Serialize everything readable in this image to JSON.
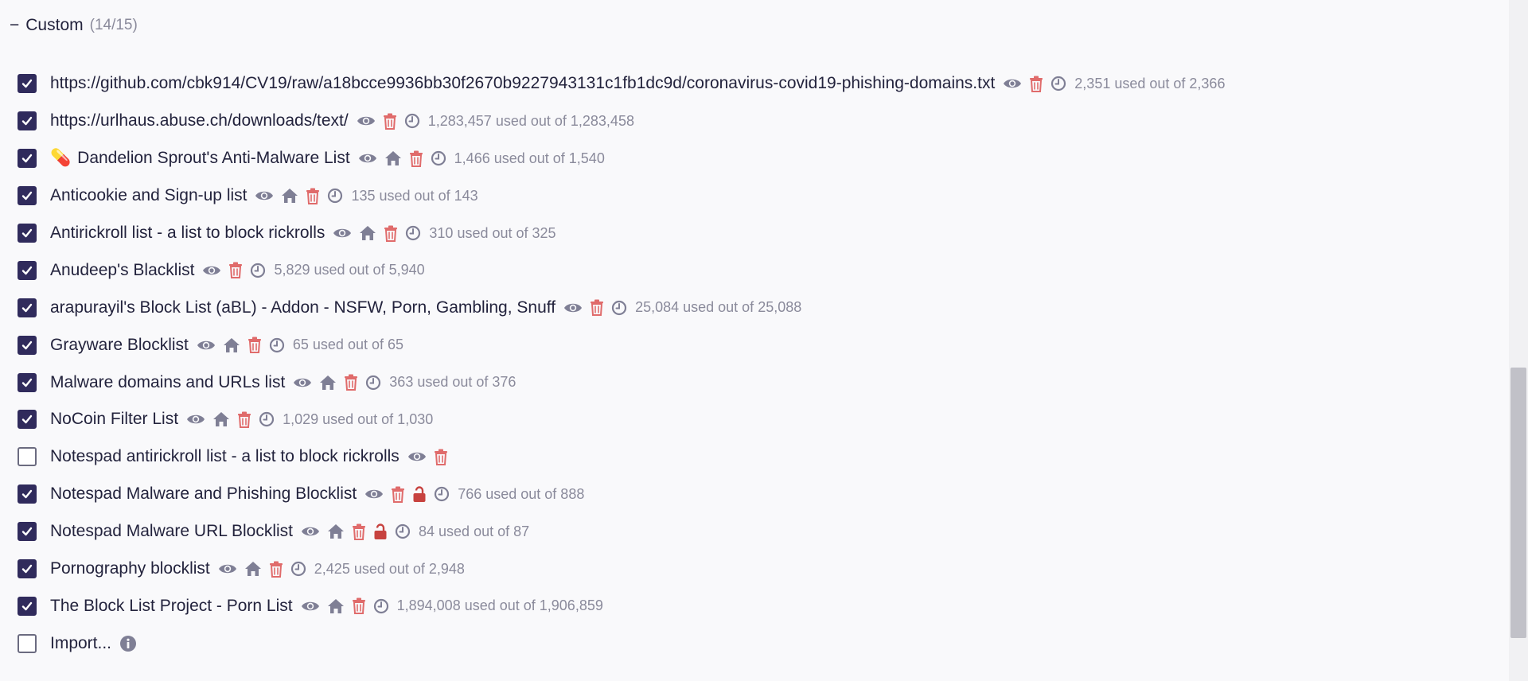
{
  "section": {
    "toggle": "−",
    "title": "Custom",
    "count": "(14/15)"
  },
  "colors": {
    "checkbox": "#302b5c",
    "view_icon": "#7f7f95",
    "trash_icon": "#e06b6b",
    "lock_icon": "#c7423f",
    "text_muted": "#8a8a9b"
  },
  "lists": [
    {
      "name": "https://github.com/cbk914/CV19/raw/a18bcce9936bb30f2670b9227943131c1fb1dc9d/coronavirus-covid19-phishing-domains.txt",
      "checked": true,
      "home": false,
      "lock": false,
      "emoji": "",
      "stats": "2,351 used out of 2,366"
    },
    {
      "name": "https://urlhaus.abuse.ch/downloads/text/",
      "checked": true,
      "home": false,
      "lock": false,
      "emoji": "",
      "stats": "1,283,457 used out of 1,283,458"
    },
    {
      "name": "Dandelion Sprout's Anti-Malware List",
      "checked": true,
      "home": true,
      "lock": false,
      "emoji": "💊",
      "stats": "1,466 used out of 1,540"
    },
    {
      "name": "Anticookie and Sign-up list",
      "checked": true,
      "home": true,
      "lock": false,
      "emoji": "",
      "stats": "135 used out of 143"
    },
    {
      "name": "Antirickroll list - a list to block rickrolls",
      "checked": true,
      "home": true,
      "lock": false,
      "emoji": "",
      "stats": "310 used out of 325"
    },
    {
      "name": "Anudeep's Blacklist",
      "checked": true,
      "home": false,
      "lock": false,
      "emoji": "",
      "stats": "5,829 used out of 5,940"
    },
    {
      "name": "arapurayil's Block List (aBL) - Addon - NSFW, Porn, Gambling, Snuff",
      "checked": true,
      "home": false,
      "lock": false,
      "emoji": "",
      "stats": "25,084 used out of 25,088"
    },
    {
      "name": "Grayware Blocklist",
      "checked": true,
      "home": true,
      "lock": false,
      "emoji": "",
      "stats": "65 used out of 65"
    },
    {
      "name": "Malware domains and URLs list",
      "checked": true,
      "home": true,
      "lock": false,
      "emoji": "",
      "stats": "363 used out of 376"
    },
    {
      "name": "NoCoin Filter List",
      "checked": true,
      "home": true,
      "lock": false,
      "emoji": "",
      "stats": "1,029 used out of 1,030"
    },
    {
      "name": "Notespad antirickroll list - a list to block rickrolls",
      "checked": false,
      "home": false,
      "lock": false,
      "emoji": "",
      "stats": ""
    },
    {
      "name": "Notespad Malware and Phishing Blocklist",
      "checked": true,
      "home": false,
      "lock": true,
      "emoji": "",
      "stats": "766 used out of 888"
    },
    {
      "name": "Notespad Malware URL Blocklist",
      "checked": true,
      "home": true,
      "lock": true,
      "emoji": "",
      "stats": "84 used out of 87"
    },
    {
      "name": "Pornography blocklist",
      "checked": true,
      "home": true,
      "lock": false,
      "emoji": "",
      "stats": "2,425 used out of 2,948"
    },
    {
      "name": "The Block List Project - Porn List",
      "checked": true,
      "home": true,
      "lock": false,
      "emoji": "",
      "stats": "1,894,008 used out of 1,906,859"
    }
  ],
  "import": {
    "label": "Import...",
    "checked": false
  },
  "scrollbar": {
    "position": 0.55
  }
}
